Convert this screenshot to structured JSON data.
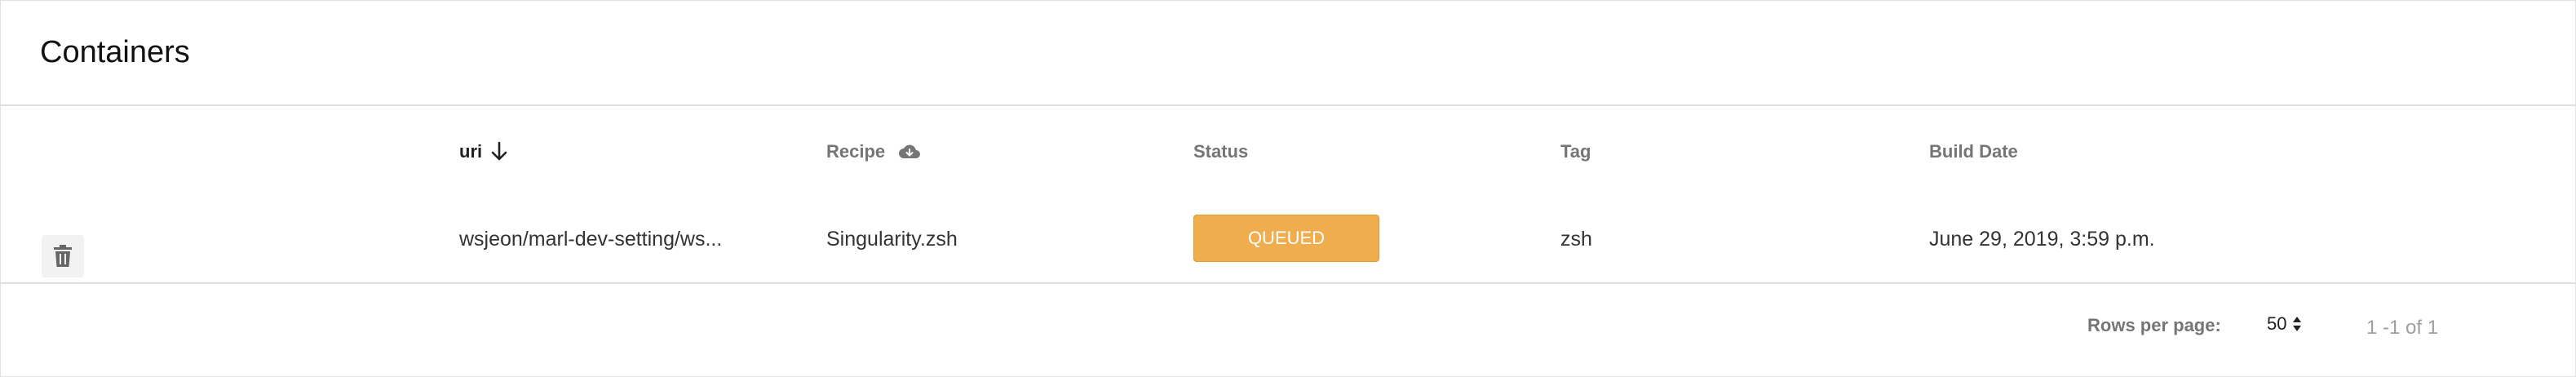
{
  "card": {
    "title": "Containers"
  },
  "columns": {
    "uri": "uri",
    "recipe": "Recipe",
    "status": "Status",
    "tag": "Tag",
    "build_date": "Build Date"
  },
  "rows": [
    {
      "uri": "wsjeon/marl-dev-setting/ws...",
      "recipe": "Singularity.zsh",
      "status": "QUEUED",
      "tag": "zsh",
      "build_date": "June 29, 2019, 3:59 p.m."
    }
  ],
  "pagination": {
    "rows_per_page_label": "Rows per page:",
    "rows_per_page": "50",
    "range": "1 -1 of 1"
  },
  "colors": {
    "queued": "#f0ad4e"
  },
  "icons": {
    "sort": "arrow-down-icon",
    "recipe": "cloud-download-icon",
    "delete": "trash-icon",
    "select": "up-down-arrows-icon"
  }
}
